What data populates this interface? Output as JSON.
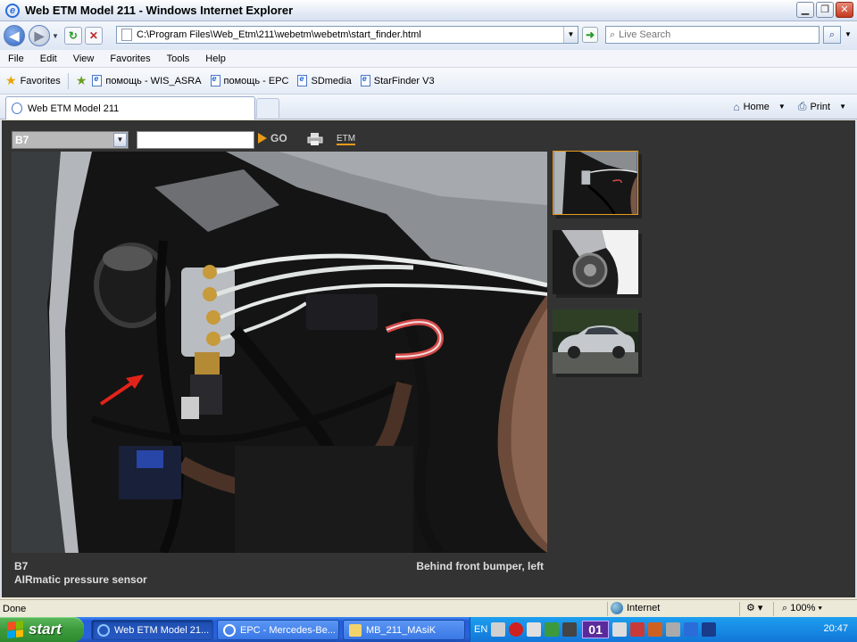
{
  "window": {
    "title": "Web ETM Model 211 - Windows Internet Explorer"
  },
  "addressbar": {
    "url": "C:\\Program Files\\Web_Etm\\211\\webetm\\webetm\\start_finder.html",
    "search_placeholder": "Live Search"
  },
  "menu": [
    "File",
    "Edit",
    "View",
    "Favorites",
    "Tools",
    "Help"
  ],
  "favorites": {
    "label": "Favorites",
    "links": [
      "помощь - WIS_ASRA",
      "помощь - EPC",
      "SDmedia",
      "StarFinder V3"
    ]
  },
  "tabs": [
    {
      "label": "Web ETM Model 211"
    }
  ],
  "tabtools": {
    "home": "Home",
    "print": "Print"
  },
  "content": {
    "component_select": "B7",
    "search_value": "",
    "go_label": "GO",
    "etm_label": "ETM",
    "caption": {
      "code": "B7",
      "name": "AIRmatic pressure sensor",
      "location": "Behind front bumper, left"
    }
  },
  "status": {
    "text": "Done",
    "zone": "Internet",
    "zoom": "100%"
  },
  "taskbar": {
    "start": "start",
    "items": [
      "Web ETM Model 21...",
      "EPC - Mercedes-Be...",
      "MB_211_MAsiK"
    ],
    "lang": "EN",
    "badge": "01",
    "clock": "20:47"
  },
  "colors": {
    "accent": "#e89a1a",
    "content_bg": "#333333",
    "taskbar": "#245edb"
  }
}
